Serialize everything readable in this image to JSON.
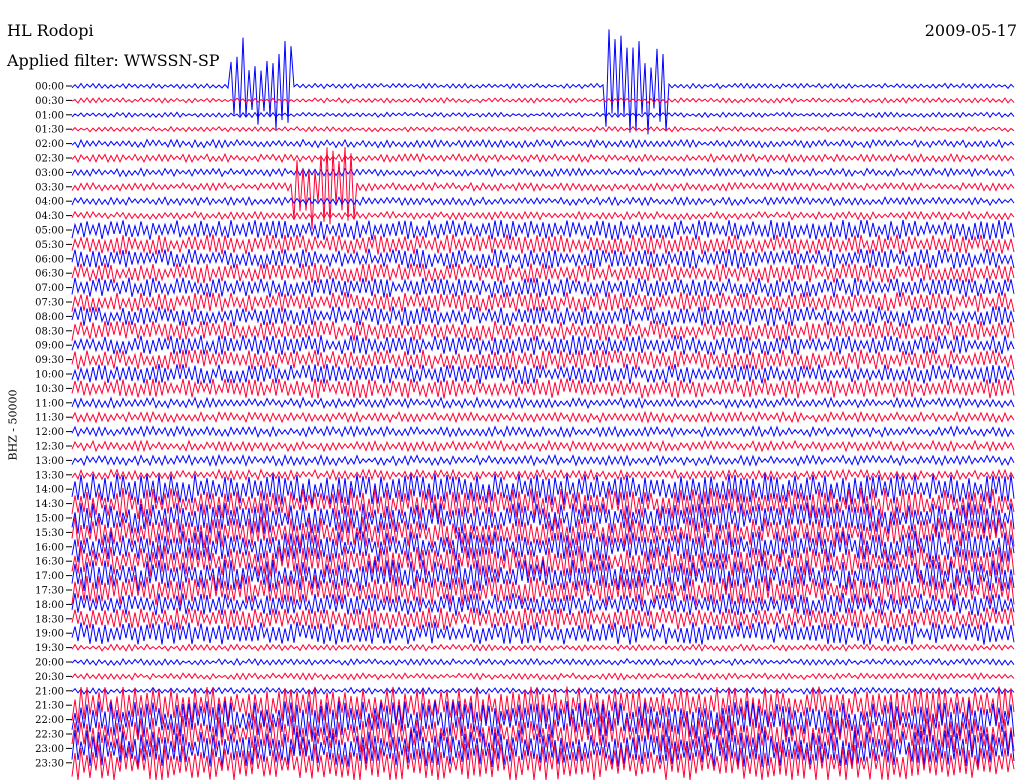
{
  "header": {
    "station": "HL Rodopi",
    "date": "2009-05-17",
    "filter": "Applied filter: WWSSN-SP"
  },
  "chart_data": {
    "type": "line",
    "title": "HL Rodopi",
    "subtitle": "Applied filter: WWSSN-SP",
    "date": "2009-05-17",
    "ylabel": "BHZ - 50000",
    "xlabel": "",
    "tick_labels": [
      "00:00",
      "00:30",
      "01:00",
      "01:30",
      "02:00",
      "02:30",
      "03:00",
      "03:30",
      "04:00",
      "04:30",
      "05:00",
      "05:30",
      "06:00",
      "06:30",
      "07:00",
      "07:30",
      "08:00",
      "08:30",
      "09:00",
      "09:30",
      "10:00",
      "10:30",
      "11:00",
      "11:30",
      "12:00",
      "12:30",
      "13:00",
      "13:30",
      "14:00",
      "14:30",
      "15:00",
      "15:30",
      "16:00",
      "16:30",
      "17:00",
      "17:30",
      "18:00",
      "18:30",
      "19:00",
      "19:30",
      "20:00",
      "20:30",
      "21:00",
      "21:30",
      "22:00",
      "22:30",
      "23:00",
      "23:30"
    ],
    "trace_minutes": 30,
    "series_colors": [
      "#0000ff",
      "#ff0033"
    ],
    "grid": false,
    "legend": "none",
    "amplitude_profile": [
      {
        "from": 0,
        "to": 4,
        "level": 0.35
      },
      {
        "from": 4,
        "to": 10,
        "level": 0.55
      },
      {
        "from": 10,
        "to": 22,
        "level": 1.4
      },
      {
        "from": 22,
        "to": 28,
        "level": 0.7
      },
      {
        "from": 28,
        "to": 36,
        "level": 2.2
      },
      {
        "from": 36,
        "to": 39,
        "level": 1.6
      },
      {
        "from": 39,
        "to": 43,
        "level": 0.45
      },
      {
        "from": 43,
        "to": 48,
        "level": 2.6
      }
    ],
    "events": [
      {
        "trace": 0,
        "start_min": 5,
        "end_min": 7,
        "peak": 7.0
      },
      {
        "trace": 0,
        "start_min": 17,
        "end_min": 19,
        "peak": 8.0
      },
      {
        "trace": 7,
        "start_min": 7,
        "end_min": 9,
        "peak": 6.0
      },
      {
        "trace": 38,
        "start_min": 0,
        "end_min": 30,
        "peak": 0.3
      }
    ]
  }
}
